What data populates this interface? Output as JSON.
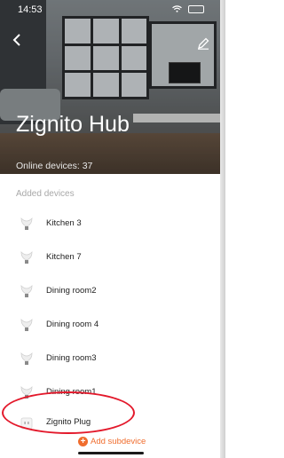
{
  "status_bar": {
    "time": "14:53"
  },
  "header": {
    "title": "Zignito Hub",
    "online_devices": "Online devices: 37"
  },
  "section": {
    "label": "Added devices"
  },
  "devices": [
    {
      "name": "Kitchen 3",
      "icon": "bulb-icon"
    },
    {
      "name": "Kitchen 7",
      "icon": "bulb-icon"
    },
    {
      "name": "Dining room2",
      "icon": "bulb-icon"
    },
    {
      "name": "Dining room 4",
      "icon": "bulb-icon"
    },
    {
      "name": "Dining room3",
      "icon": "bulb-icon"
    },
    {
      "name": "Dining room1",
      "icon": "bulb-icon"
    },
    {
      "name": "Zignito Plug",
      "icon": "plug-icon"
    }
  ],
  "footer": {
    "add_label": "Add subdevice"
  },
  "colors": {
    "accent": "#f06d2e",
    "highlight": "#e3192b"
  }
}
